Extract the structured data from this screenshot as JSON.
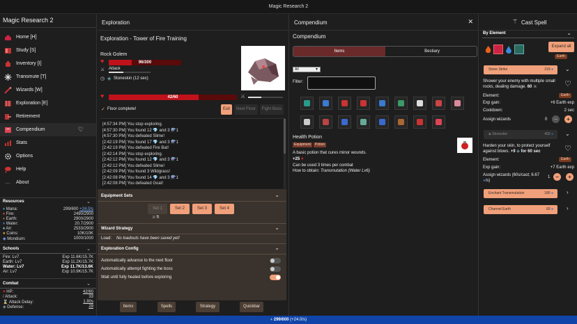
{
  "window": {
    "title": "Magic Research 2"
  },
  "sidebar": {
    "title": "Magic Research 2",
    "items": [
      {
        "label": "Home [H]",
        "icon": "house-icon"
      },
      {
        "label": "Study [S]",
        "icon": "book-icon"
      },
      {
        "label": "Inventory [I]",
        "icon": "bag-icon"
      },
      {
        "label": "Transmute [T]",
        "icon": "transmute-icon"
      },
      {
        "label": "Wizards [W]",
        "icon": "wand-icon"
      },
      {
        "label": "Exploration [E]",
        "icon": "map-icon"
      },
      {
        "label": "Retirement",
        "icon": "exit-icon"
      },
      {
        "label": "Compendium",
        "icon": "tome-icon"
      },
      {
        "label": "Stats",
        "icon": "stats-icon"
      },
      {
        "label": "Options",
        "icon": "gear-icon"
      },
      {
        "label": "Help",
        "icon": "help-icon"
      },
      {
        "label": "About",
        "icon": "dots-icon"
      }
    ],
    "resources": {
      "header": "Resources",
      "rows": [
        {
          "name": "Mana:",
          "value": "299/600",
          "rate": "+24.0/s"
        },
        {
          "name": "Fire:",
          "value": "2490/2900",
          "rate": ""
        },
        {
          "name": "Earth:",
          "value": "2900/2900",
          "rate": ""
        },
        {
          "name": "Water:",
          "value": "20.7/2900",
          "rate": ""
        },
        {
          "name": "Air:",
          "value": "2533/2900",
          "rate": ""
        },
        {
          "name": "Coins:",
          "value": "10K/10K",
          "rate": ""
        },
        {
          "name": "Mondium:",
          "value": "1000/1000",
          "rate": ""
        }
      ]
    },
    "schools": {
      "header": "Schools",
      "rows": [
        {
          "name": "Fire: Lv7",
          "value": "Exp 11.6K/15.7K"
        },
        {
          "name": "Earth: Lv7",
          "value": "Exp 11.2K/15.7K"
        },
        {
          "name": "Water: Lv7",
          "value": "Exp 11.7K/13.6K"
        },
        {
          "name": "Air: Lv7",
          "value": "Exp 10.9K/15.7K"
        }
      ]
    },
    "combat": {
      "header": "Combat",
      "rows": [
        {
          "name": "HP:",
          "value": "42/60"
        },
        {
          "name": "Attack:",
          "value": "33"
        },
        {
          "name": "Attack Delay:",
          "value": "1.90s"
        },
        {
          "name": "Defense:",
          "value": "29"
        }
      ]
    }
  },
  "exploration": {
    "header": "Exploration",
    "subtitle": "Exploration - Tower of Fire Training",
    "enemy": {
      "name": "Rock Golem",
      "hp_text": "96/300",
      "hp_fraction": 0.32
    },
    "enemy_attack_label": "Attack",
    "enemy_attack_progress": 0.35,
    "stoneskin_label": "Stoneskin (12 sec)",
    "player": {
      "hp_text": "42/60",
      "hp_fraction": 0.7
    },
    "floor_complete": "Floor complete!",
    "buttons": {
      "exit": "Exit",
      "next_floor": "Next Floor",
      "fight_boss": "Fight Boss"
    },
    "log": [
      "[4:57:34 PM] You stop exploring.",
      "[4:57:30 PM] You found 12 💎 and 3 ⚗️1",
      "[4:57:30 PM] You defeated Slime!",
      "[2:42:19 PM] You found 17 💎 and 3 ⚗️1",
      "[2:42:19 PM] You defeated Fire Bat!",
      "[2:42:14 PM] You stop exploring.",
      "[2:42:12 PM] You found 12 💎 and 3 ⚗️1",
      "[2:42:12 PM] You defeated Slime!",
      "[2:42:09 PM] You found 3 Wildgrass!",
      "[2:42:08 PM] You found 14 💎 and 3 ⚗️1",
      "[2:42:08 PM] You defeated Goat!"
    ],
    "equipment_sets": {
      "header": "Equipment Sets",
      "sets": [
        "Set 1",
        "Set 2",
        "Set 3",
        "Set 4"
      ]
    },
    "wizard_strategy": {
      "header": "Wizard Strategy",
      "load_label": "Load:",
      "load_value": "No loadouts have been saved yet!"
    },
    "exploration_config": {
      "header": "Exploration Config",
      "options": [
        {
          "label": "Automatically advance to the next floor",
          "on": false
        },
        {
          "label": "Automatically attempt fighting the boss",
          "on": false
        },
        {
          "label": "Wait until fully healed before exploring",
          "on": true
        }
      ]
    },
    "tabs": [
      "Items",
      "Spells",
      "Strategy",
      "Quickbar"
    ]
  },
  "compendium": {
    "header": "Compendium",
    "subtitle": "Compendium",
    "tabs": [
      "Items",
      "Bestiary"
    ],
    "select_value": "All",
    "filter_label": "Filter:",
    "filter_value": "",
    "item": {
      "name": "Health Potion",
      "tags": [
        "Equipment",
        "Potion"
      ],
      "description": "A basic potion that cures minor wounds.",
      "effect": "+25",
      "uses": "Can be used 3 times per combat",
      "obtain_label": "How to obtain:",
      "obtain_value": "Transmutation (Water Lv6)"
    }
  },
  "cast": {
    "header": "Cast Spell",
    "by_element": "By Element",
    "expand_all": "Expand all",
    "earth_tag": "Earth",
    "spells": [
      {
        "name": "Stone Strike",
        "cost": "219"
      },
      {
        "name": "Stoneskin",
        "cost": "400"
      }
    ],
    "stone_strike": {
      "desc": "Shower your enemy with multiple small rocks, dealing damage.",
      "dmg": "60",
      "element_label": "Element:",
      "element_value": "Earth",
      "exp_label": "Exp gain:",
      "exp_value": "+6 Earth exp",
      "cd_label": "Cooldown:",
      "cd_value": "2 sec",
      "assign_label": "Assign wizards",
      "assign_value": "0"
    },
    "stoneskin": {
      "desc": "Harden your skin, to protect yourself against blows.",
      "bonus": "+9",
      "dur": "for 60 sec",
      "element_label": "Element:",
      "element_value": "Earth",
      "exp_label": "Exp gain:",
      "exp_value": "+7 Earth exp",
      "assign_label": "Assign wizards (60s/cast; 6.67",
      "assign_label2": "/s)",
      "assign_value": "1"
    },
    "more_spells": [
      {
        "name": "Enchant Transmutation",
        "cost": "180"
      },
      {
        "name": "Channel Earth",
        "cost": "60"
      }
    ]
  },
  "statusbar": {
    "mana": "299/600",
    "rate": "(+24.0/s)"
  }
}
